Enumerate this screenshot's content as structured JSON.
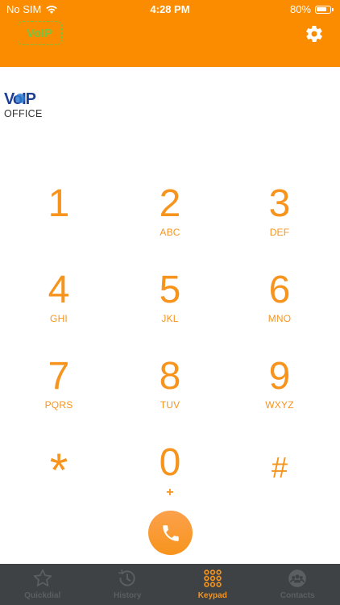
{
  "status_bar": {
    "carrier": "No SIM",
    "time": "4:28 PM",
    "battery": "80%",
    "battery_level": 0.8
  },
  "header": {
    "badge": "VoIP"
  },
  "logo": {
    "line1": "VoIP",
    "line2": "OFFICE"
  },
  "keypad": {
    "keys": [
      {
        "digit": "1",
        "letters": ""
      },
      {
        "digit": "2",
        "letters": "ABC"
      },
      {
        "digit": "3",
        "letters": "DEF"
      },
      {
        "digit": "4",
        "letters": "GHI"
      },
      {
        "digit": "5",
        "letters": "JKL"
      },
      {
        "digit": "6",
        "letters": "MNO"
      },
      {
        "digit": "7",
        "letters": "PQRS"
      },
      {
        "digit": "8",
        "letters": "TUV"
      },
      {
        "digit": "9",
        "letters": "WXYZ"
      },
      {
        "digit": "*",
        "letters": ""
      },
      {
        "digit": "0",
        "letters": "+"
      },
      {
        "digit": "#",
        "letters": ""
      }
    ]
  },
  "tabs": [
    {
      "label": "Quickdial",
      "icon": "star-icon",
      "active": false
    },
    {
      "label": "History",
      "icon": "history-icon",
      "active": false
    },
    {
      "label": "Keypad",
      "icon": "keypad-icon",
      "active": true
    },
    {
      "label": "Contacts",
      "icon": "contacts-icon",
      "active": false
    }
  ],
  "colors": {
    "accent": "#fb8c00",
    "digit": "#f7941d",
    "tabbar": "#3e4244",
    "badge": "#7cc242"
  }
}
